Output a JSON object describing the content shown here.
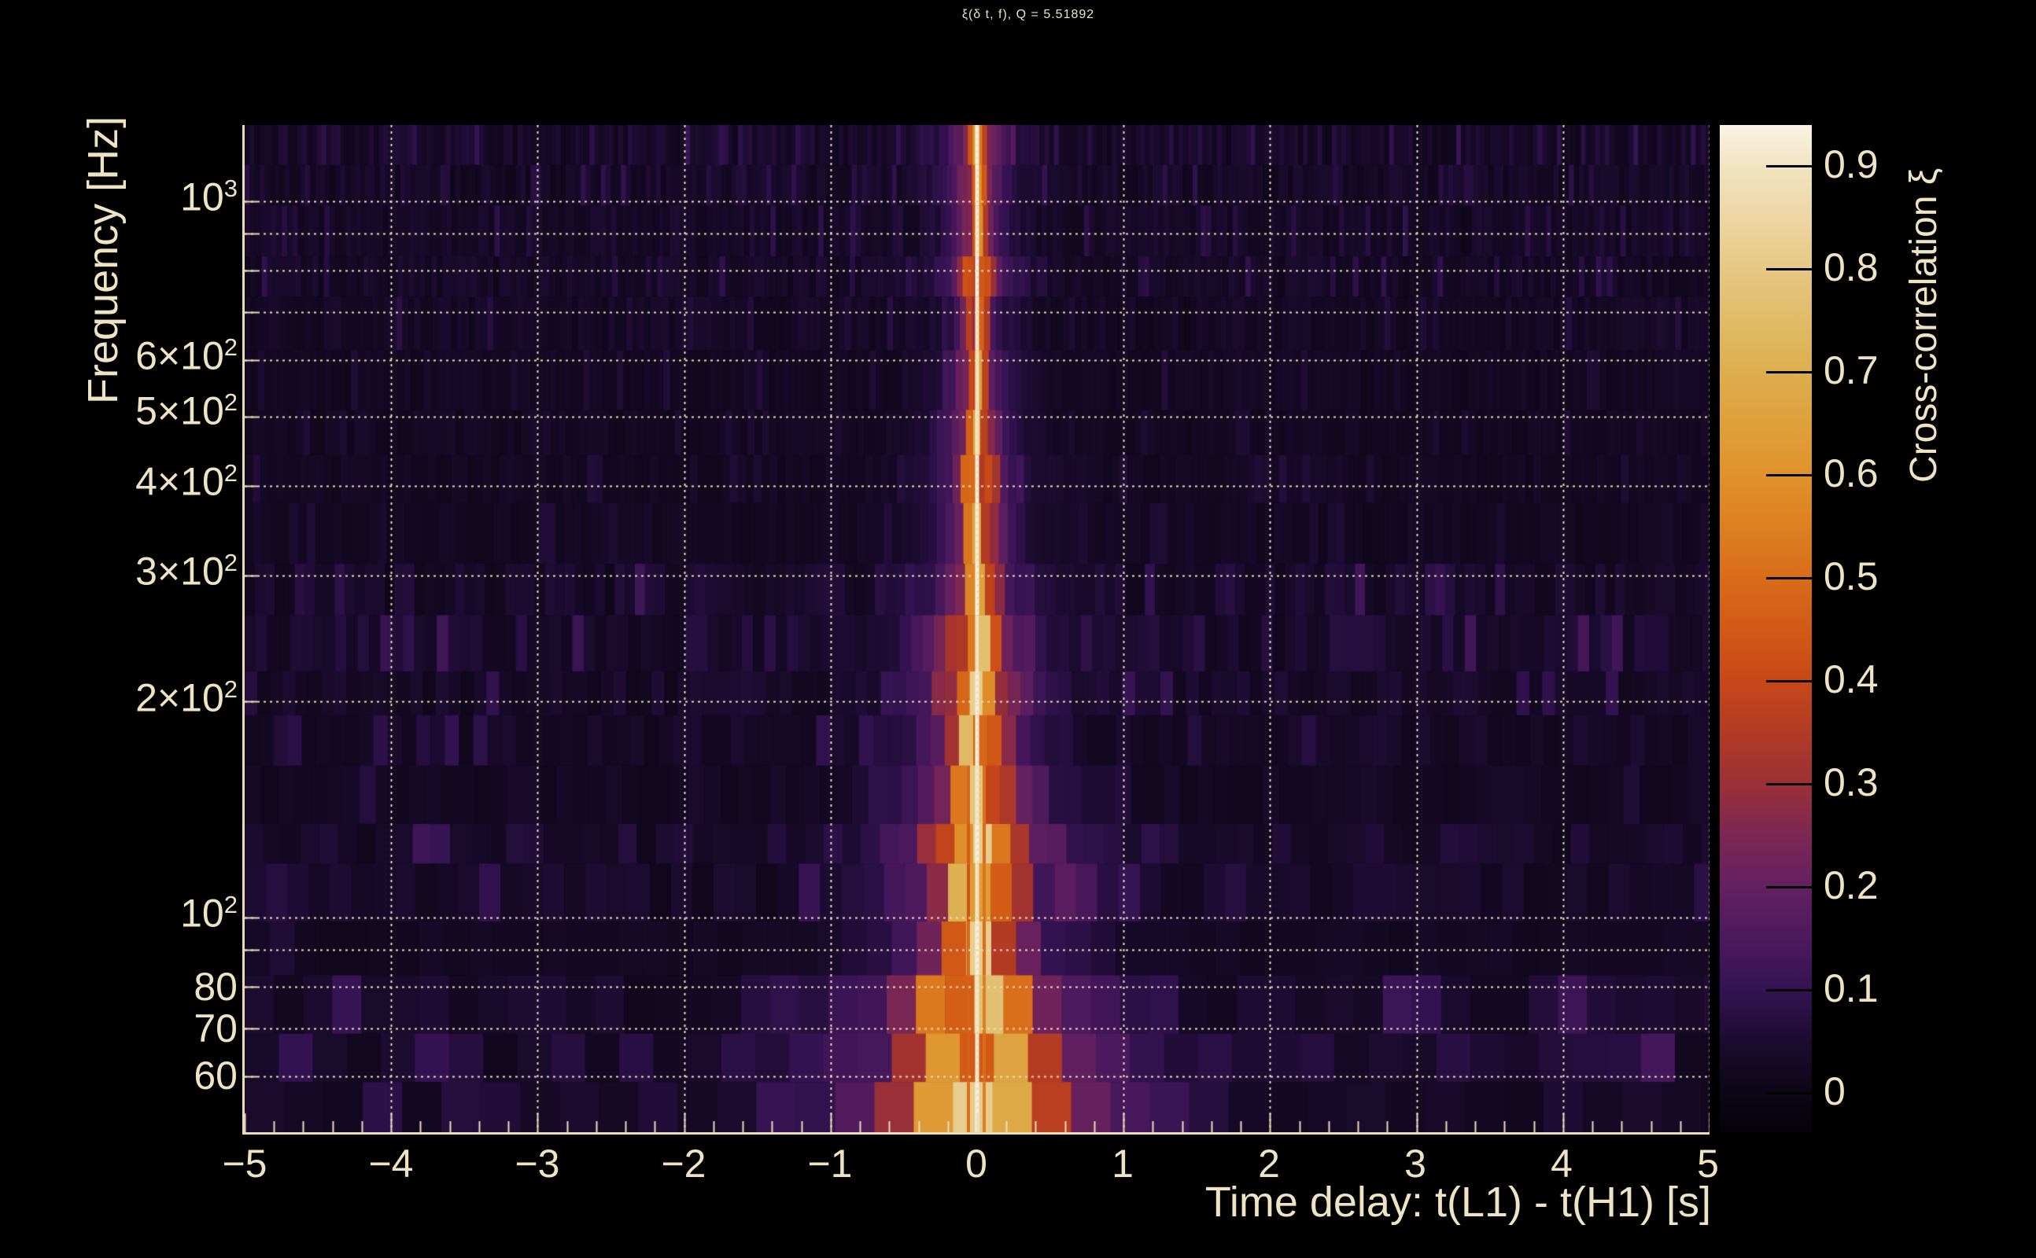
{
  "title": {
    "text": "ξ(δ t, f), Q = 5.51892"
  },
  "x_axis": {
    "title": "Time delay: t(L1) - t(H1) [s]",
    "ticks": [
      {
        "label": "−5",
        "value": -5
      },
      {
        "label": "−4",
        "value": -4
      },
      {
        "label": "−3",
        "value": -3
      },
      {
        "label": "−2",
        "value": -2
      },
      {
        "label": "−1",
        "value": -1
      },
      {
        "label": "0",
        "value": 0
      },
      {
        "label": "1",
        "value": 1
      },
      {
        "label": "2",
        "value": 2
      },
      {
        "label": "3",
        "value": 3
      },
      {
        "label": "4",
        "value": 4
      },
      {
        "label": "5",
        "value": 5
      }
    ],
    "minor_tick_step": 0.2
  },
  "y_axis": {
    "title": "Frequency [Hz]",
    "ticks": [
      {
        "base": "10",
        "sup": "3",
        "hz": 1000
      },
      {
        "base": "6×10",
        "sup": "2",
        "hz": 600
      },
      {
        "base": "5×10",
        "sup": "2",
        "hz": 500
      },
      {
        "base": "4×10",
        "sup": "2",
        "hz": 400
      },
      {
        "base": "3×10",
        "sup": "2",
        "hz": 300
      },
      {
        "base": "2×10",
        "sup": "2",
        "hz": 200
      },
      {
        "base": "10",
        "sup": "2",
        "hz": 100
      },
      {
        "base": "80",
        "hz": 80
      },
      {
        "base": "70",
        "hz": 70
      },
      {
        "base": "60",
        "hz": 60
      }
    ]
  },
  "colorbar": {
    "title": "Cross-correlation ξ",
    "tick_labels": [
      "0.9",
      "0.8",
      "0.7",
      "0.6",
      "0.5",
      "0.4",
      "0.3",
      "0.2",
      "0.1",
      "0"
    ],
    "tick_values": [
      0.9,
      0.8,
      0.7,
      0.6,
      0.5,
      0.4,
      0.3,
      0.2,
      0.1,
      0
    ]
  },
  "colors": {
    "background": "#000000",
    "text": "#eee3c4",
    "grid": "#e9ddb9",
    "axis": "#e9ddb9",
    "colorbar_tick": "#000000"
  },
  "chart_data": {
    "type": "heatmap",
    "title": "ξ(δ t, f), Q = 5.51892",
    "q_value": 5.51892,
    "xlabel": "Time delay: t(L1) - t(H1) [s]",
    "ylabel": "Frequency [Hz]",
    "zlabel": "Cross-correlation ξ",
    "xlim": [
      -5,
      5
    ],
    "ylim_hz": [
      50.1,
      1277
    ],
    "y_scale": "log",
    "zlim": [
      -0.04,
      0.94
    ],
    "grid": "dotted, at x integers and at log-decade mantissa frequencies",
    "x_gridlines": [
      -4,
      -3,
      -2,
      -1,
      0,
      1,
      2,
      3,
      4,
      5
    ],
    "y_gridlines_hz": [
      60,
      70,
      80,
      90,
      100,
      200,
      300,
      400,
      500,
      600,
      700,
      800,
      900,
      1000
    ],
    "ridge": {
      "delta_t_s": 0,
      "peak_xi": 0.93,
      "core_xi": 0.9,
      "glow_xi": 0.6,
      "description": "narrow bright cross-correlation ridge at zero time delay spanning all frequencies; cream-white core line with orange glow that widens toward low frequency and is brightest below 60 Hz; purple fringes"
    },
    "background_xi_range": [
      0,
      0.1
    ],
    "colormap_stops": [
      [
        -0.04,
        "#050208"
      ],
      [
        0.0,
        "#0d0617"
      ],
      [
        0.05,
        "#1c0c30"
      ],
      [
        0.1,
        "#351353"
      ],
      [
        0.15,
        "#4c1a5e"
      ],
      [
        0.2,
        "#642060"
      ],
      [
        0.25,
        "#7d2753"
      ],
      [
        0.3,
        "#9c3037"
      ],
      [
        0.35,
        "#b23b25"
      ],
      [
        0.4,
        "#c84818"
      ],
      [
        0.45,
        "#d25a16"
      ],
      [
        0.5,
        "#d96c1a"
      ],
      [
        0.55,
        "#dd7f22"
      ],
      [
        0.6,
        "#e0922c"
      ],
      [
        0.65,
        "#dfa03c"
      ],
      [
        0.7,
        "#ddae4d"
      ],
      [
        0.75,
        "#e1bb68"
      ],
      [
        0.8,
        "#e5c883"
      ],
      [
        0.85,
        "#ecd6a3"
      ],
      [
        0.9,
        "#f2e4c2"
      ],
      [
        0.94,
        "#f9f3e6"
      ]
    ]
  }
}
